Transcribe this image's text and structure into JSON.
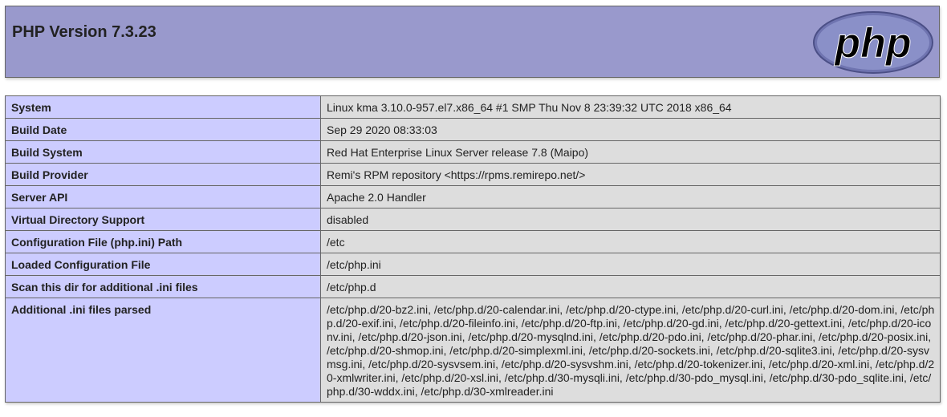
{
  "header": {
    "title": "PHP Version 7.3.23",
    "logo_text": "php"
  },
  "colors": {
    "header_bg": "#9999cc",
    "label_bg": "#ccccff",
    "value_bg": "#dddddd",
    "border": "#666666"
  },
  "rows": [
    {
      "label": "System",
      "value": "Linux kma 3.10.0-957.el7.x86_64 #1 SMP Thu Nov 8 23:39:32 UTC 2018 x86_64"
    },
    {
      "label": "Build Date",
      "value": "Sep 29 2020 08:33:03"
    },
    {
      "label": "Build System",
      "value": "Red Hat Enterprise Linux Server release 7.8 (Maipo)"
    },
    {
      "label": "Build Provider",
      "value": "Remi's RPM repository <https://rpms.remirepo.net/>"
    },
    {
      "label": "Server API",
      "value": "Apache 2.0 Handler"
    },
    {
      "label": "Virtual Directory Support",
      "value": "disabled"
    },
    {
      "label": "Configuration File (php.ini) Path",
      "value": "/etc"
    },
    {
      "label": "Loaded Configuration File",
      "value": "/etc/php.ini"
    },
    {
      "label": "Scan this dir for additional .ini files",
      "value": "/etc/php.d"
    },
    {
      "label": "Additional .ini files parsed",
      "value": "/etc/php.d/20-bz2.ini, /etc/php.d/20-calendar.ini, /etc/php.d/20-ctype.ini, /etc/php.d/20-curl.ini, /etc/php.d/20-dom.ini, /etc/php.d/20-exif.ini, /etc/php.d/20-fileinfo.ini, /etc/php.d/20-ftp.ini, /etc/php.d/20-gd.ini, /etc/php.d/20-gettext.ini, /etc/php.d/20-iconv.ini, /etc/php.d/20-json.ini, /etc/php.d/20-mysqlnd.ini, /etc/php.d/20-pdo.ini, /etc/php.d/20-phar.ini, /etc/php.d/20-posix.ini, /etc/php.d/20-shmop.ini, /etc/php.d/20-simplexml.ini, /etc/php.d/20-sockets.ini, /etc/php.d/20-sqlite3.ini, /etc/php.d/20-sysvmsg.ini, /etc/php.d/20-sysvsem.ini, /etc/php.d/20-sysvshm.ini, /etc/php.d/20-tokenizer.ini, /etc/php.d/20-xml.ini, /etc/php.d/20-xmlwriter.ini, /etc/php.d/20-xsl.ini, /etc/php.d/30-mysqli.ini, /etc/php.d/30-pdo_mysql.ini, /etc/php.d/30-pdo_sqlite.ini, /etc/php.d/30-wddx.ini, /etc/php.d/30-xmlreader.ini"
    }
  ]
}
